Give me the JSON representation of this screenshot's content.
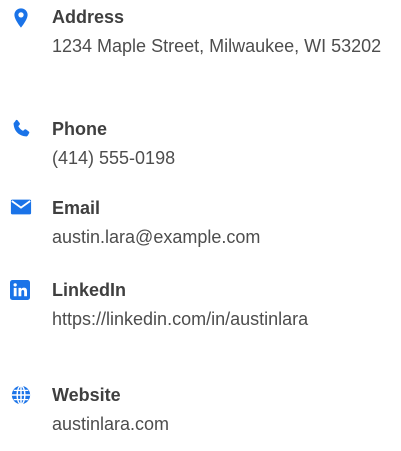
{
  "accent_color": "#1a73e8",
  "contacts": [
    {
      "icon": "location-pin-icon",
      "label": "Address",
      "value": "1234 Maple Street, Milwaukee, WI 53202"
    },
    {
      "icon": "phone-icon",
      "label": "Phone",
      "value": "(414) 555-0198"
    },
    {
      "icon": "envelope-icon",
      "label": "Email",
      "value": "austin.lara@example.com"
    },
    {
      "icon": "linkedin-icon",
      "label": "LinkedIn",
      "value": "https://linkedin.com/in/austinlara"
    },
    {
      "icon": "globe-icon",
      "label": "Website",
      "value": "austinlara.com"
    }
  ]
}
